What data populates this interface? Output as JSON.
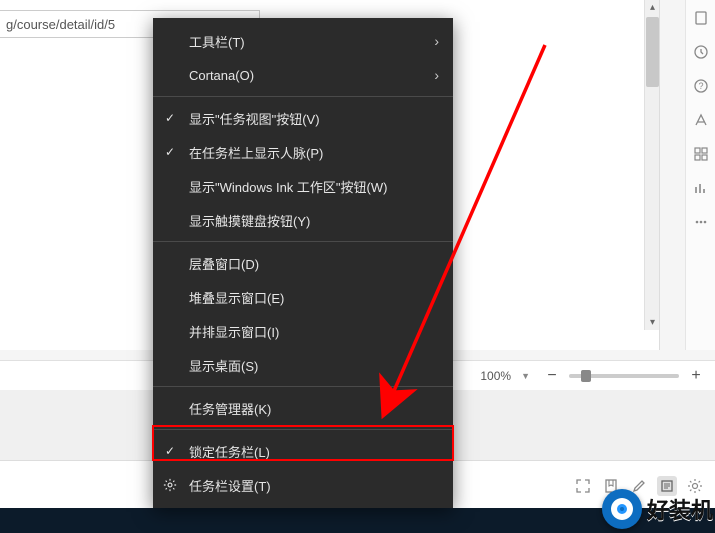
{
  "address_bar": {
    "text": "g/course/detail/id/5"
  },
  "zoom": {
    "label": "100%",
    "minus": "−",
    "plus": "+"
  },
  "context_menu": {
    "items": [
      {
        "label": "工具栏(T)",
        "submenu": true
      },
      {
        "label": "Cortana(O)",
        "submenu": true
      },
      {
        "sep": true
      },
      {
        "label": "显示\"任务视图\"按钮(V)",
        "checked": true
      },
      {
        "label": "在任务栏上显示人脉(P)",
        "checked": true
      },
      {
        "label": "显示\"Windows Ink 工作区\"按钮(W)"
      },
      {
        "label": "显示触摸键盘按钮(Y)"
      },
      {
        "sep": true
      },
      {
        "label": "层叠窗口(D)"
      },
      {
        "label": "堆叠显示窗口(E)"
      },
      {
        "label": "并排显示窗口(I)"
      },
      {
        "label": "显示桌面(S)"
      },
      {
        "sep": true
      },
      {
        "label": "任务管理器(K)"
      },
      {
        "sep": true
      },
      {
        "label": "锁定任务栏(L)",
        "checked": true
      },
      {
        "label": "任务栏设置(T)",
        "icon": "gear"
      }
    ]
  },
  "right_toolbar": {
    "icons": [
      "page",
      "history",
      "help",
      "font",
      "grid",
      "chart",
      "more"
    ]
  },
  "bottom_icons": [
    "fullscreen",
    "bookmark",
    "edit",
    "read",
    "settings"
  ],
  "watermark": {
    "text": "好装机"
  },
  "highlight_color": "#ff0000"
}
